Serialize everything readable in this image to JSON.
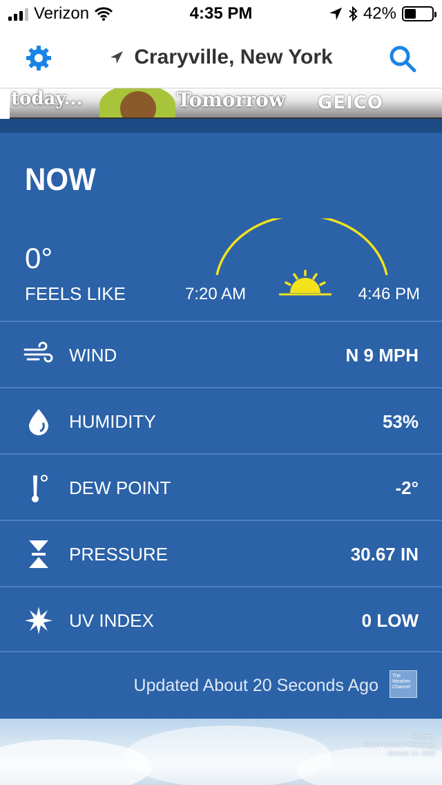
{
  "status_bar": {
    "carrier": "Verizon",
    "time": "4:35 PM",
    "battery_percent": "42%",
    "battery_level": 0.42
  },
  "nav": {
    "location": "Craryville, New York"
  },
  "ad": {
    "left_text": "today...",
    "mid_text": "Tomorrow",
    "brand": "GEICO"
  },
  "now": {
    "heading": "NOW",
    "temperature": "0°",
    "feels_like_label": "FEELS LIKE",
    "sunrise": "7:20 AM",
    "sunset": "4:46 PM"
  },
  "rows": [
    {
      "icon": "wind-icon",
      "label": "WIND",
      "value": "N 9 MPH"
    },
    {
      "icon": "humidity-drop-icon",
      "label": "HUMIDITY",
      "value": "53%"
    },
    {
      "icon": "thermometer-icon",
      "label": "DEW POINT",
      "value": "-2°"
    },
    {
      "icon": "pressure-icon",
      "label": "PRESSURE",
      "value": "30.67 IN"
    },
    {
      "icon": "uv-sun-icon",
      "label": "UV INDEX",
      "value": "0 LOW"
    }
  ],
  "updated_text": "Updated About 20 Seconds Ago",
  "logo_text": "The Weather Channel",
  "photo_credit": {
    "source": "Reuters",
    "place": "Mount Mason, Philippines",
    "date": "January 14, 2018"
  },
  "colors": {
    "panel": "#2b62a8",
    "accent_blue": "#1a84e6",
    "sun_yellow": "#f3e21c"
  }
}
